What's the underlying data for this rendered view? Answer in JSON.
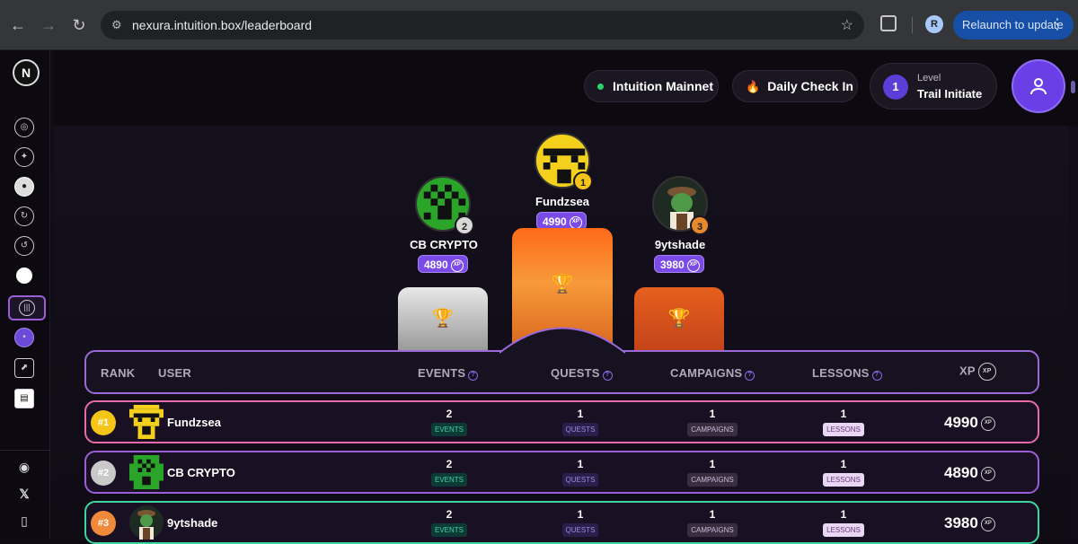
{
  "browser": {
    "url": "nexura.intuition.box/leaderboard",
    "profile_initial": "R",
    "relaunch_label": "Relaunch to update"
  },
  "header": {
    "network_label": "Intuition Mainnet",
    "checkin_label": "Daily Check In",
    "level_caption": "Level",
    "level_number": "1",
    "level_name": "Trail Initiate"
  },
  "podium": {
    "first": {
      "rank": "1",
      "name": "Fundzsea",
      "xp": "4990"
    },
    "second": {
      "rank": "2",
      "name": "CB CRYPTO",
      "xp": "4890"
    },
    "third": {
      "rank": "3",
      "name": "9ytshade",
      "xp": "3980"
    }
  },
  "table": {
    "headers": {
      "rank": "RANK",
      "user": "USER",
      "events": "EVENTS",
      "quests": "QUESTS",
      "campaigns": "CAMPAIGNS",
      "lessons": "LESSONS",
      "xp": "XP"
    },
    "tags": {
      "events": "EVENTS",
      "quests": "QUESTS",
      "campaigns": "CAMPAIGNS",
      "lessons": "LESSONS"
    },
    "rows": [
      {
        "rank": "#1",
        "name": "Fundzsea",
        "events": "2",
        "quests": "1",
        "campaigns": "1",
        "lessons": "1",
        "xp": "4990"
      },
      {
        "rank": "#2",
        "name": "CB CRYPTO",
        "events": "2",
        "quests": "1",
        "campaigns": "1",
        "lessons": "1",
        "xp": "4890"
      },
      {
        "rank": "#3",
        "name": "9ytshade",
        "events": "2",
        "quests": "1",
        "campaigns": "1",
        "lessons": "1",
        "xp": "3980"
      }
    ]
  },
  "xp_coin_label": "XP",
  "colors": {
    "rank1": "#f5c518",
    "rank2": "#c9c9c9",
    "rank3": "#f08a3a",
    "accent": "#7b4be8"
  }
}
